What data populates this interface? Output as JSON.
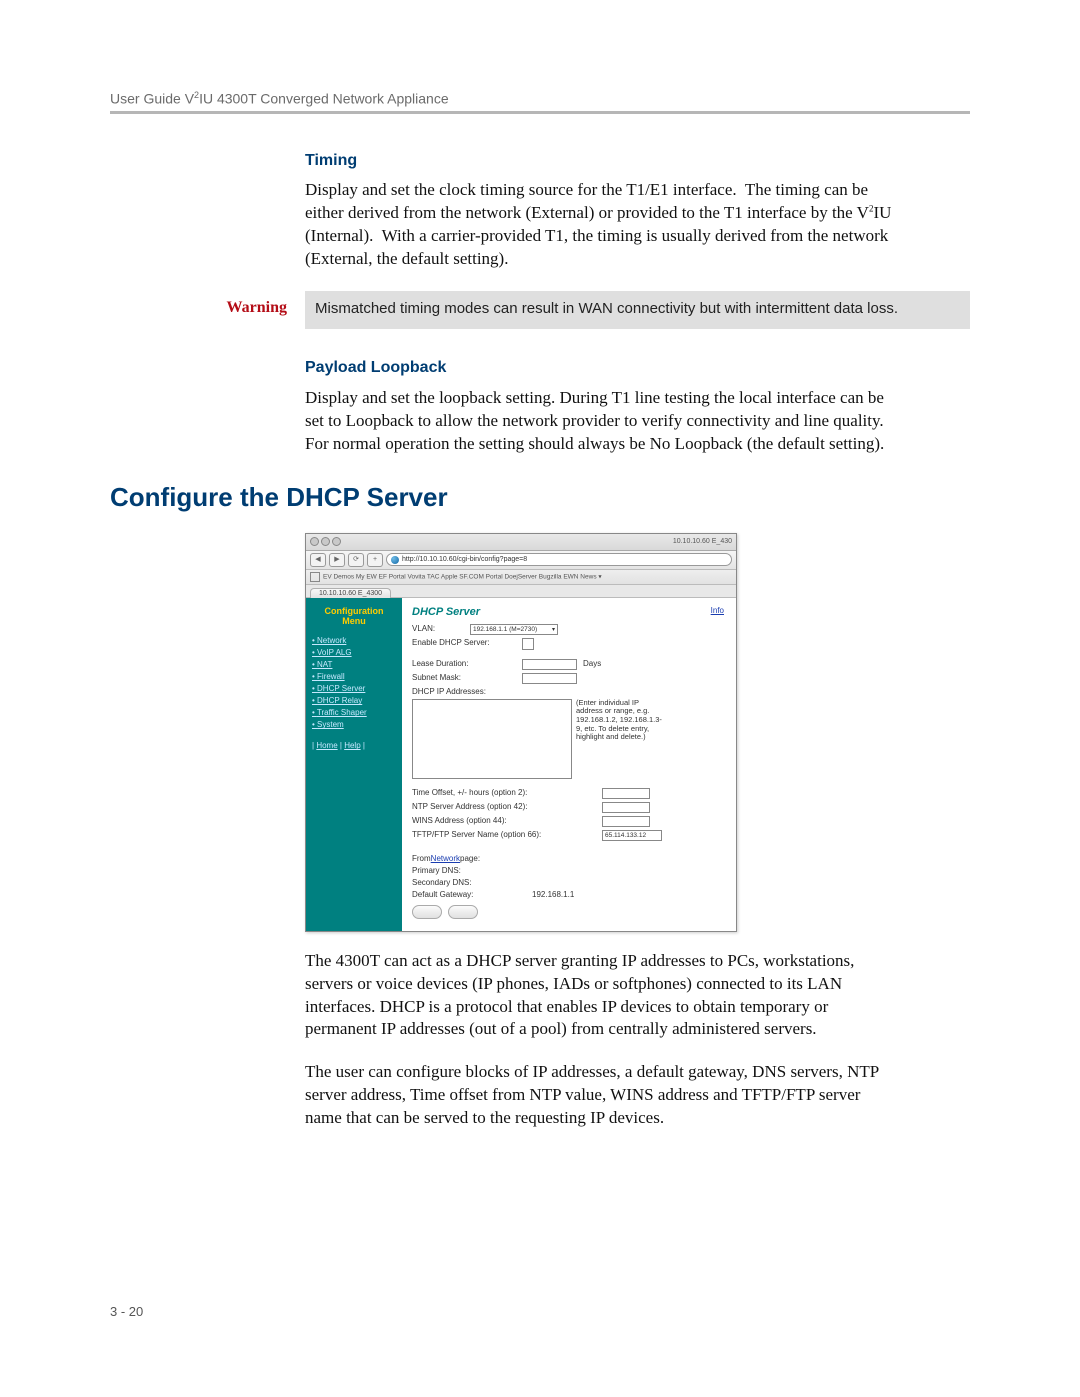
{
  "header": {
    "line": "User Guide V²IU 4300T Converged Network Appliance"
  },
  "sections": {
    "timing": {
      "heading": "Timing",
      "body": "Display and set the clock timing source for the T1/E1 interface.  The timing can be either derived from the network (External) or provided to the T1 interface by the V²IU (Internal).  With a carrier-provided T1, the timing is usually derived from the network (External, the default setting)."
    },
    "warning": {
      "label": "Warning",
      "text": "Mismatched timing modes can result in WAN connectivity but with intermittent data loss."
    },
    "payload": {
      "heading": "Payload Loopback",
      "body": "Display and set the loopback setting.  During T1 line testing the local interface can be set to Loopback to allow the network provider to verify connectivity and line quality.  For normal operation the setting should always be No Loopback (the default setting)."
    },
    "dhcp": {
      "heading": "Configure the DHCP Server",
      "body1": "The 4300T can act as a DHCP server granting IP addresses to PCs, workstations, servers or voice devices (IP phones, IADs or softphones) connected to its LAN interfaces. DHCP is a protocol that enables IP devices to obtain temporary or permanent IP addresses (out of a pool) from centrally administered servers.",
      "body2": "The user can configure blocks of IP addresses, a default gateway, DNS servers, NTP server address, Time offset from NTP value, WINS address and TFTP/FTP server name that can be served to the requesting IP devices."
    }
  },
  "screenshot": {
    "window_title": "10.10.10.60 E_430",
    "url": "http://10.10.10.60/cgi-bin/config?page=8",
    "bookmarks": "EV Demos   My EW   EF Portal   Vovita TAC   Apple   SF.COM   Portal   DoejServer   Bugzilla   EWN   News ▾",
    "tab": "10.10.10.60 E_4300",
    "sidebar": {
      "title": "Configuration Menu",
      "items": [
        "Network",
        "VoIP ALG",
        "NAT",
        "Firewall",
        "DHCP Server",
        "DHCP Relay",
        "Traffic Shaper",
        "System"
      ],
      "footer_home": "Home",
      "footer_help": "Help"
    },
    "main": {
      "title": "DHCP Server",
      "info": "Info",
      "vlan_label": "VLAN:",
      "vlan_value": "192.168.1.1 (M=2730)",
      "enable_label": "Enable DHCP Server:",
      "lease_label": "Lease Duration:",
      "lease_unit": "Days",
      "subnet_label": "Subnet Mask:",
      "addr_label": "DHCP IP Addresses:",
      "addr_hint": "(Enter individual IP address or range, e.g. 192.168.1.2, 192.168.1.3-9, etc. To delete entry, highlight and delete.)",
      "opt2": "Time Offset, +/- hours (option 2):",
      "opt42": "NTP Server Address (option 42):",
      "opt44": "WINS Address (option 44):",
      "opt66": "TFTP/FTP Server Name (option 66):",
      "opt66_value": "65.114.133.12",
      "from_net_pre": "From ",
      "from_net_link": "Network",
      "from_net_post": " page:",
      "pdns": "Primary DNS:",
      "sdns": "Secondary DNS:",
      "gw_label": "Default Gateway:",
      "gw_value": "192.168.1.1"
    }
  },
  "footer": {
    "page": "3 - 20"
  }
}
